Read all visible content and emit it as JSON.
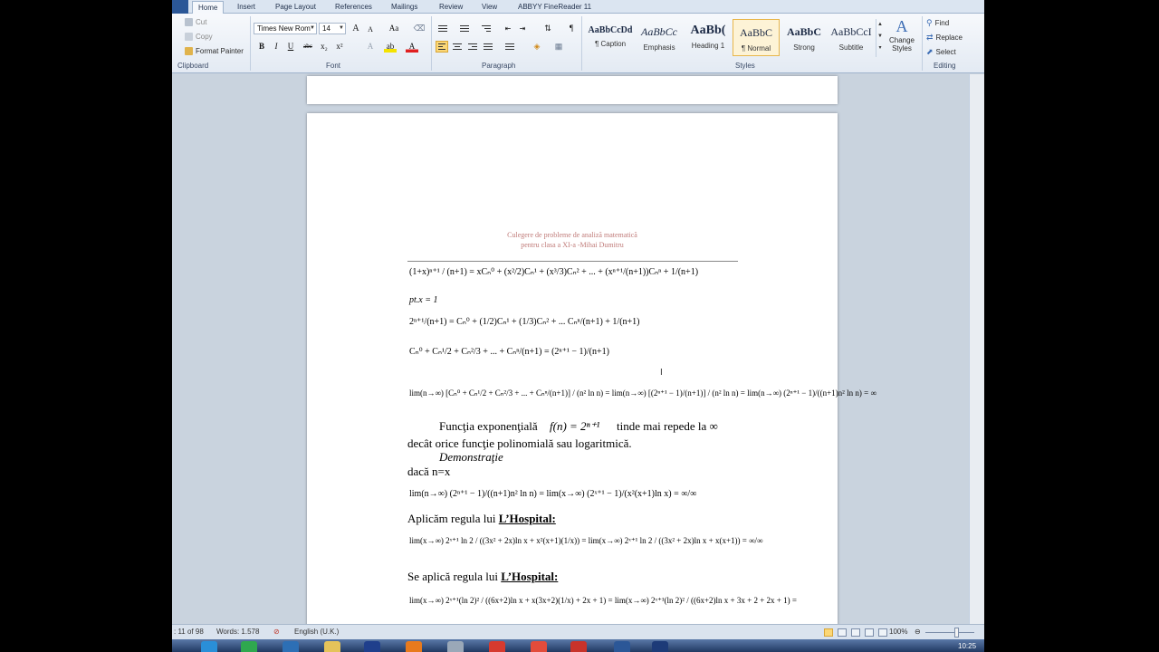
{
  "tabs": [
    "Home",
    "Insert",
    "Page Layout",
    "References",
    "Mailings",
    "Review",
    "View",
    "ABBYY FineReader 11"
  ],
  "active_tab": "Home",
  "clipboard": {
    "cut": "Cut",
    "copy": "Copy",
    "format_painter": "Format Painter",
    "label": "Clipboard"
  },
  "font": {
    "name": "Times New Rom",
    "size": "14",
    "label": "Font",
    "bold": "B",
    "italic": "I",
    "underline": "U",
    "strike": "abc",
    "subscript": "x₂",
    "superscript": "x²",
    "grow": "A",
    "shrink": "A",
    "change_case": "Aa"
  },
  "paragraph": {
    "label": "Paragraph"
  },
  "styles": {
    "label": "Styles",
    "items": [
      {
        "sample": "AaBbCcDd",
        "name": "¶ Caption"
      },
      {
        "sample": "AaBbCc",
        "name": "Emphasis"
      },
      {
        "sample": "AaBb(",
        "name": "Heading 1"
      },
      {
        "sample": "AaBbC",
        "name": "¶ Normal"
      },
      {
        "sample": "AaBbC",
        "name": "Strong"
      },
      {
        "sample": "AaBbCcI",
        "name": "Subtitle"
      }
    ],
    "change_styles": "Change Styles"
  },
  "editing": {
    "find": "Find",
    "replace": "Replace",
    "select": "Select",
    "label": "Editing"
  },
  "document": {
    "header_line1": "Culegere de probleme de analiză matematică",
    "header_line2": "pentru clasa a XI-a -Mihai Dumitru",
    "eq1": "(1+x)ⁿ⁺¹ / (n+1) = xCₙ⁰ + (x²/2)Cₙ¹ + (x³/3)Cₙ² + ... + (xⁿ⁺¹/(n+1))Cₙⁿ + 1/(n+1)",
    "eq2": "pt.x = 1",
    "eq3": "2ⁿ⁺¹/(n+1) = Cₙ⁰ + (1/2)Cₙ¹ + (1/3)Cₙ² + ... Cₙⁿ/(n+1) + 1/(n+1)",
    "eq4": "Cₙ⁰ + Cₙ¹/2 + Cₙ²/3 + ... + Cₙⁿ/(n+1) = (2ⁿ⁺¹ − 1)/(n+1)",
    "eq5": "lim(n→∞) [Cₙ⁰ + Cₙ¹/2 + Cₙ²/3 + ... + Cₙⁿ/(n+1)] / (n² ln n) = lim(n→∞) [(2ⁿ⁺¹ − 1)/(n+1)] / (n² ln n) = lim(n→∞) (2ⁿ⁺¹ − 1)/((n+1)n² ln n) = ∞",
    "para1a": "Funcţia exponenţială",
    "para1f": "f(n) = 2ⁿ⁺¹",
    "para1b": "tinde mai repede la ∞",
    "para2": "decât orice funcţie polinomială sau logaritmică.",
    "demo": "Demonstraţie",
    "daca": "dacă n=x",
    "eq6": "lim(n→∞) (2ⁿ⁺¹ − 1)/((n+1)n² ln n) = lim(x→∞) (2ˣ⁺¹ − 1)/(x²(x+1)ln x) = ∞/∞",
    "apl1": "Aplicăm  regula lui",
    "lhosp": "L’Hospital:",
    "eq7": "lim(x→∞) 2ˣ⁺¹ ln 2 / ((3x² + 2x)ln x + x²(x+1)(1/x)) = lim(x→∞) 2ˣ⁺¹ ln 2 / ((3x² + 2x)ln x + x(x+1)) = ∞/∞",
    "apl2": "Se aplică regula lui",
    "lhosp2": "L’Hospital:",
    "eq8": "lim(x→∞) 2ˣ⁺¹(ln 2)² / ((6x+2)ln x + x(3x+2)(1/x) + 2x + 1) = lim(x→∞) 2ˣ⁺¹(ln 2)² / ((6x+2)ln x + 3x + 2 + 2x + 1) ="
  },
  "status": {
    "page": ": 11 of 98",
    "words": "Words: 1.578",
    "language": "English (U.K.)",
    "zoom": "100%"
  },
  "clock": "10:25"
}
